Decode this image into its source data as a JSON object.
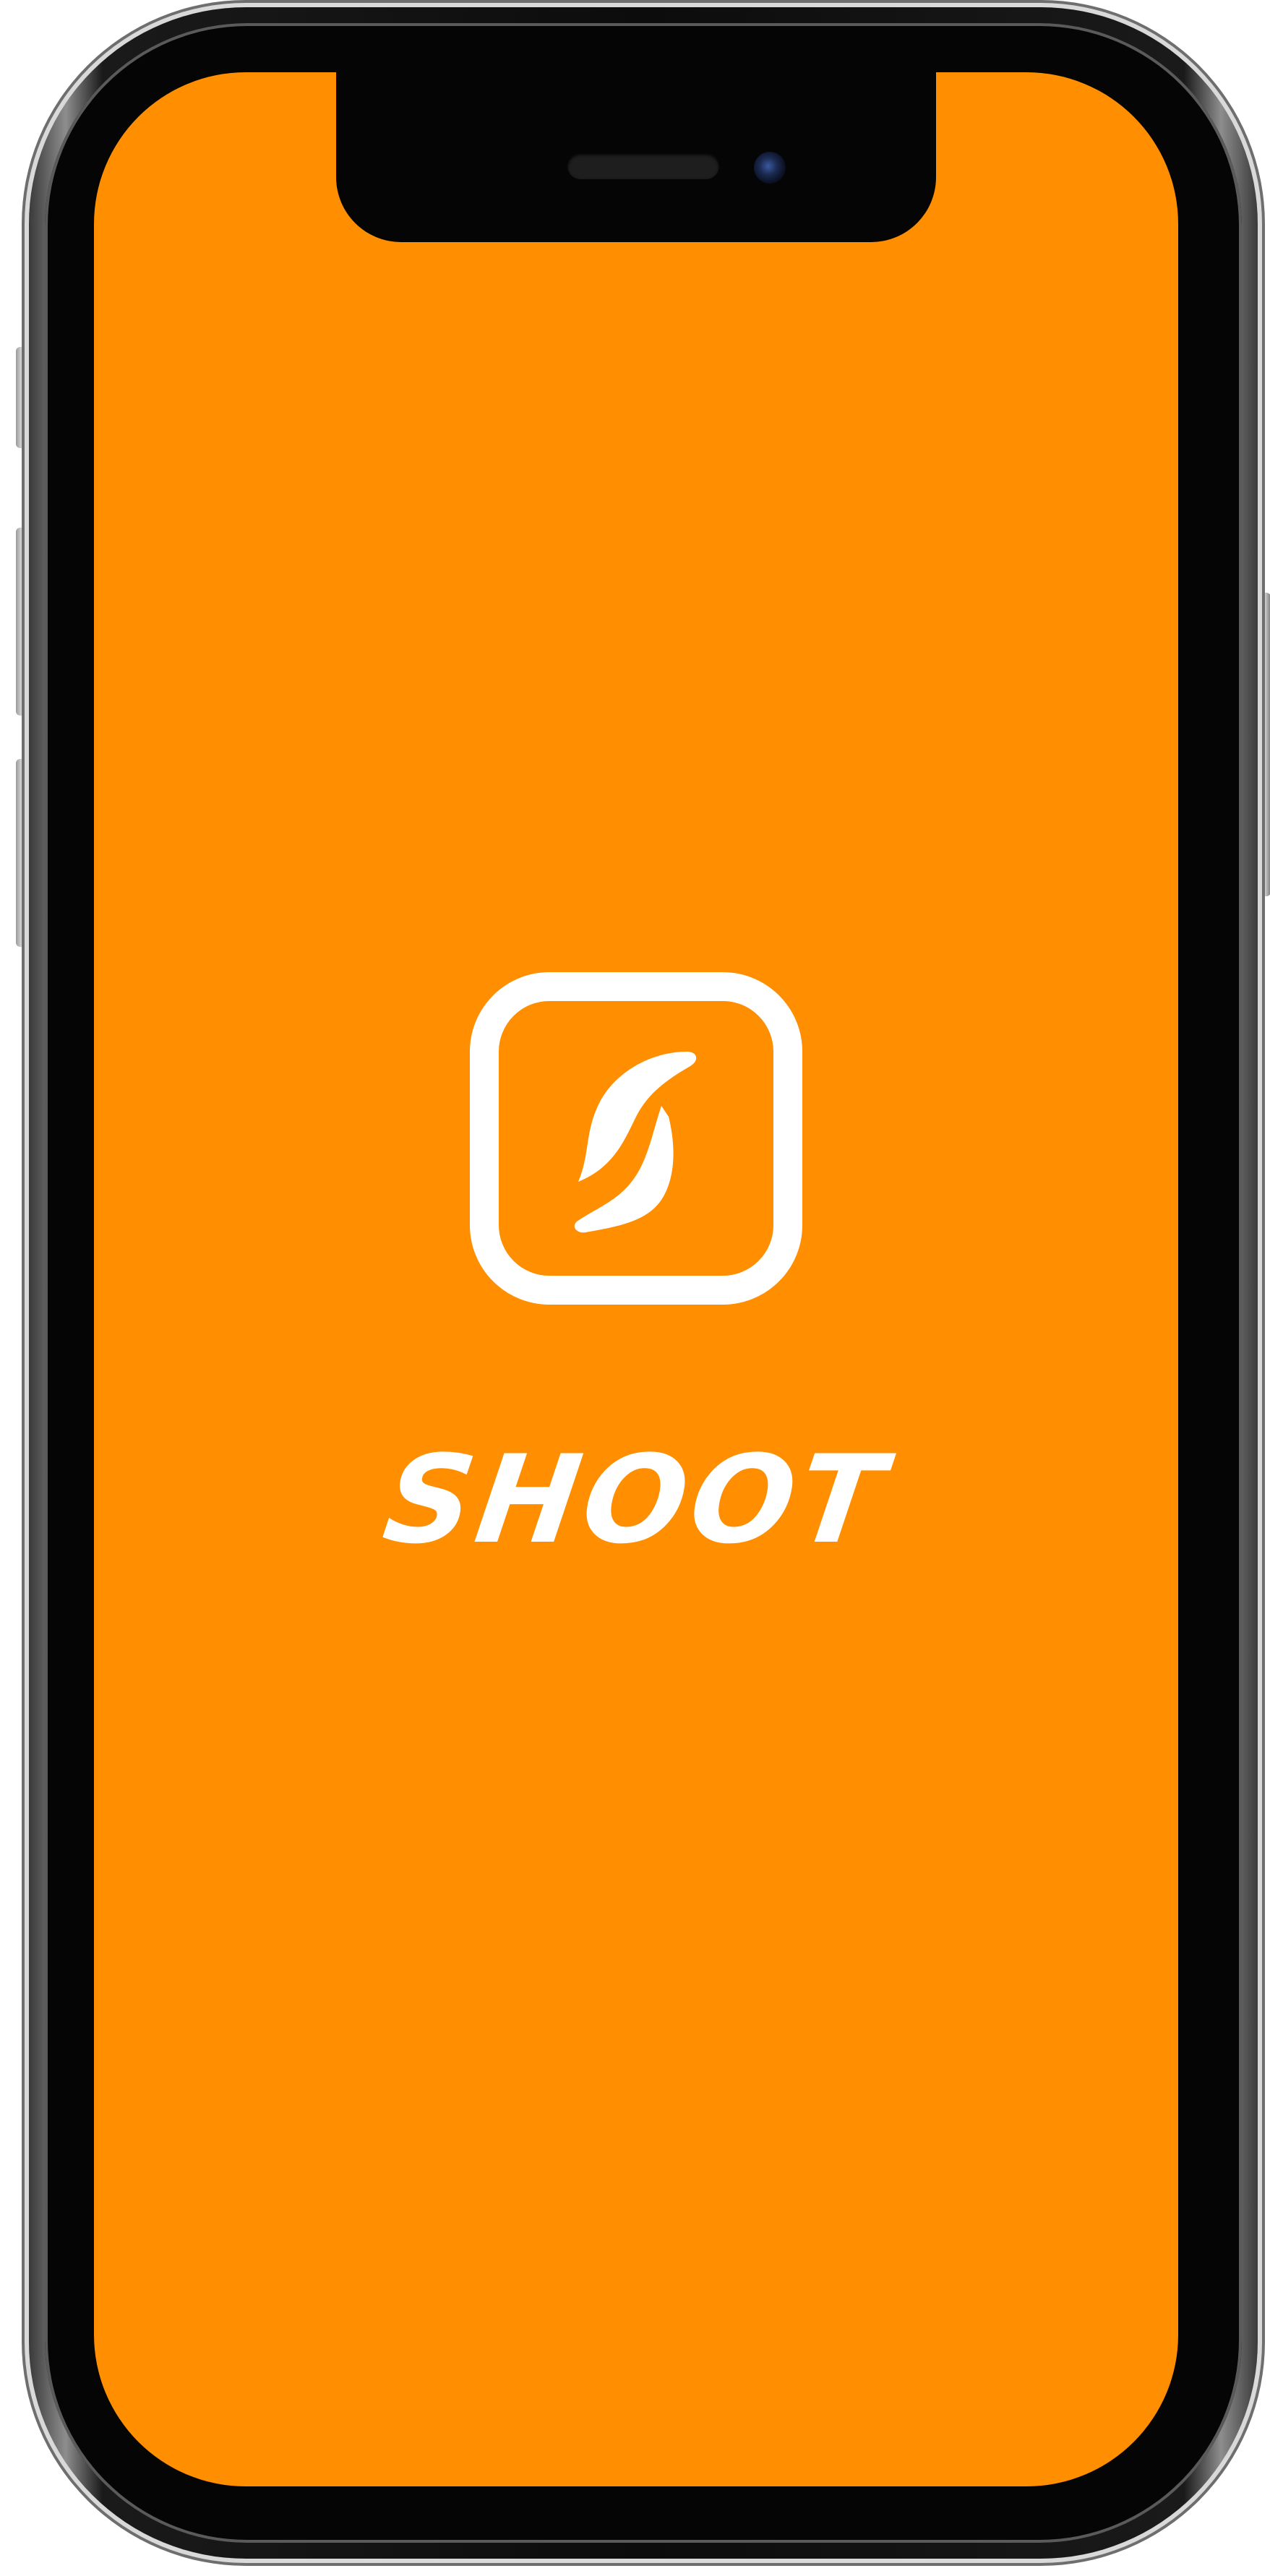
{
  "colors": {
    "screen_background": "#FF8E00",
    "logo": "#FFFFFF",
    "device_frame": "#0C0C0C"
  },
  "splash": {
    "logo_icon": "shoot-logo-icon",
    "brand_name": "SHOOT"
  },
  "device": {
    "notch_icons": [
      "speaker-icon",
      "front-camera-icon"
    ]
  }
}
